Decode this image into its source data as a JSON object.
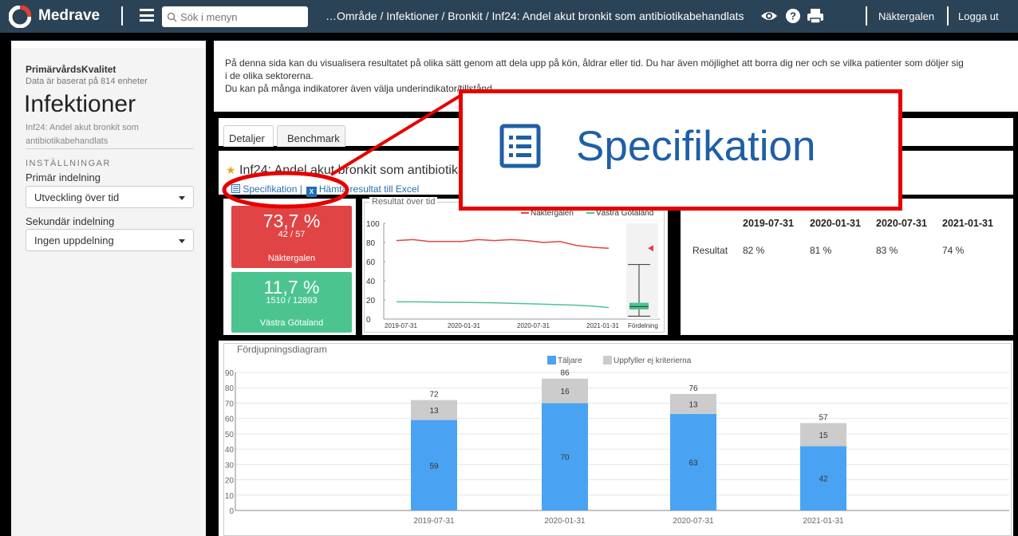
{
  "app": {
    "brand": "Medrave",
    "search_placeholder": "Sök i menyn",
    "breadcrumb": "…Område / Infektioner / Bronkit / Inf24: Andel akut bronkit som antibiotikabehandlats",
    "user": "Näktergalen",
    "logout": "Logga ut"
  },
  "sidebar": {
    "org_title": "PrimärvårdsKvalitet",
    "org_subtitle": "Data är baserat på 814 enheter",
    "page_title": "Infektioner",
    "indicator_name": "Inf24: Andel akut bronkit som antibiotikabehandlats",
    "settings_heading": "INSTÄLLNINGAR",
    "primary_label": "Primär indelning",
    "primary_value": "Utveckling över tid",
    "secondary_label": "Sekundär indelning",
    "secondary_value": "Ingen uppdelning"
  },
  "main": {
    "intro_line1": "På denna sida kan du visualisera resultatet på olika sätt genom att dela upp på kön, åldrar eller tid. Du har även möjlighet att borra dig ner och se vilka patienter som döljer sig",
    "intro_line2": "i de olika sektorerna.",
    "intro_line3": "Du kan på många indikatorer även välja underindikator/tillstånd.",
    "tabs": [
      {
        "label": "Detaljer"
      },
      {
        "label": "Benchmark"
      }
    ],
    "indicator_title": "Inf24: Andel akut bronkit som antibiotikabehandlats",
    "spec_label": "Specifikation",
    "toolbar_sep": "|",
    "excel_label": "Hämta resultat till Excel",
    "excel_badge": "X"
  },
  "kpis": [
    {
      "value": "73,7 %",
      "fraction": "42 / 57",
      "name": "Näktergalen",
      "color": "#e04444"
    },
    {
      "value": "11,7 %",
      "fraction": "1510 / 12893",
      "name": "Västra Götaland",
      "color": "#4cc48f"
    }
  ],
  "mini_chart_title": "Resultat över tid",
  "result_table": {
    "row_label": "Resultat",
    "headers": [
      "2019-07-31",
      "2020-01-31",
      "2020-07-31",
      "2021-01-31"
    ],
    "values": [
      "82 %",
      "81 %",
      "83 %",
      "74 %"
    ]
  },
  "callout": {
    "label": "Specifikation"
  },
  "chart_data": [
    {
      "type": "line",
      "title": "Resultat över tid",
      "x": [
        "2019-07-31",
        "2020-01-31",
        "2020-07-31",
        "2021-01-31"
      ],
      "x_ticks": [
        "2019-07-31",
        "2020-01-31",
        "2020-07-31",
        "2021-01-31"
      ],
      "extra_category": "Fördelning",
      "ylim": [
        0,
        100
      ],
      "y_ticks": [
        0,
        20,
        40,
        60,
        80,
        100
      ],
      "series": [
        {
          "name": "Näktergalen",
          "color": "#e04444",
          "values": [
            82,
            83,
            81,
            81,
            81,
            83,
            82,
            83,
            82,
            80,
            81,
            77,
            75,
            74
          ]
        },
        {
          "name": "Västra Götaland",
          "color": "#4cc48f",
          "values": [
            18,
            18,
            17.8,
            17.5,
            17.4,
            17.2,
            17,
            16.5,
            16,
            15.5,
            15,
            14.5,
            13.5,
            12
          ]
        }
      ],
      "distribution": {
        "min": 3,
        "q1": 10,
        "median": 13,
        "q3": 17,
        "max": 57,
        "highlight": 74
      }
    },
    {
      "type": "bar",
      "title": "Fördjupningsdiagram",
      "categories": [
        "2019-07-31",
        "2020-01-31",
        "2020-07-31",
        "2021-01-31"
      ],
      "ylim": [
        0,
        90
      ],
      "y_ticks": [
        0,
        10,
        20,
        30,
        40,
        50,
        60,
        70,
        80,
        90
      ],
      "stacked": true,
      "series": [
        {
          "name": "Täljare",
          "color": "#4aa3f2",
          "values": [
            59,
            70,
            63,
            42
          ]
        },
        {
          "name": "Uppfyller ej kriterierna",
          "color": "#cccccc",
          "values": [
            13,
            16,
            13,
            15
          ]
        }
      ],
      "totals": [
        72,
        86,
        76,
        57
      ],
      "legend": "top"
    }
  ]
}
